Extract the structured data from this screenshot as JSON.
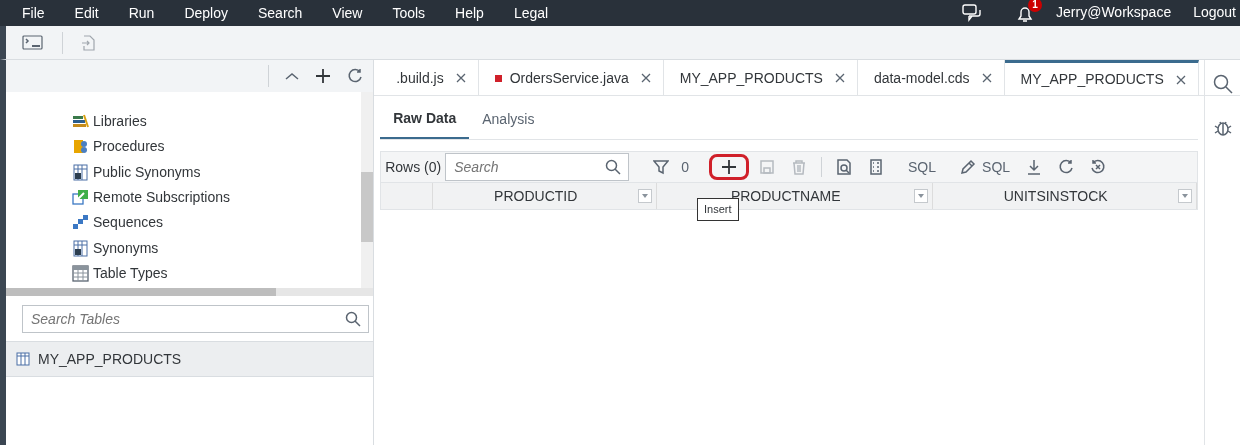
{
  "menu": [
    "File",
    "Edit",
    "Run",
    "Deploy",
    "Search",
    "View",
    "Tools",
    "Help",
    "Legal"
  ],
  "header": {
    "notification_count": "1",
    "user": "Jerry@Workspace",
    "logout": "Logout"
  },
  "tree_items": [
    {
      "label": "Libraries",
      "kind": "library"
    },
    {
      "label": "Procedures",
      "kind": "procedure"
    },
    {
      "label": "Public Synonyms",
      "kind": "synonym"
    },
    {
      "label": "Remote Subscriptions",
      "kind": "remote"
    },
    {
      "label": "Sequences",
      "kind": "sequence"
    },
    {
      "label": "Synonyms",
      "kind": "synonym"
    },
    {
      "label": "Table Types",
      "kind": "tabletype"
    }
  ],
  "table_search": {
    "placeholder": "Search Tables"
  },
  "tables": [
    {
      "label": "MY_APP_PRODUCTS",
      "selected": true
    }
  ],
  "editor_tabs": [
    {
      "label": ".build.js",
      "selected": false,
      "modified": false
    },
    {
      "label": "OrdersService.java",
      "selected": false,
      "modified": true
    },
    {
      "label": "MY_APP_PRODUCTS",
      "selected": false,
      "modified": false
    },
    {
      "label": "data-model.cds",
      "selected": false,
      "modified": false
    },
    {
      "label": "MY_APP_PRODUCTS",
      "selected": true,
      "modified": false
    }
  ],
  "view_tabs": [
    {
      "label": "Raw Data",
      "selected": true
    },
    {
      "label": "Analysis",
      "selected": false
    }
  ],
  "data_toolbar": {
    "rows": "Rows (0)",
    "search_placeholder": "Search",
    "filter_count": "0",
    "sql": "SQL",
    "edit_sql": "SQL",
    "insert_highlighted": true,
    "tooltip": "Insert"
  },
  "columns": [
    "PRODUCTID",
    "PRODUCTNAME",
    "UNITSINSTOCK"
  ]
}
